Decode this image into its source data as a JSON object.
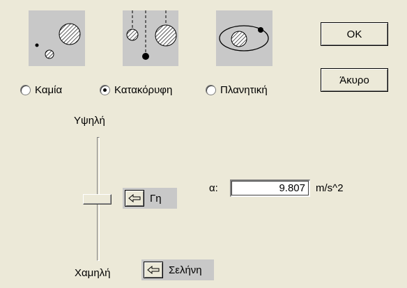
{
  "options": [
    {
      "label": "Καμία",
      "checked": false
    },
    {
      "label": "Κατακόρυφη",
      "checked": true
    },
    {
      "label": "Πλανητική",
      "checked": false
    }
  ],
  "buttons": {
    "ok": "OK",
    "cancel": "Άκυρο"
  },
  "slider": {
    "high_label": "Υψηλή",
    "low_label": "Χαμηλή",
    "level": 0.5
  },
  "presets": {
    "earth": "Γη",
    "moon": "Σελήνη"
  },
  "acceleration": {
    "label": "α:",
    "value": "9.807",
    "unit": "m/s^2"
  },
  "icons": {
    "none_picture": "balls-scattered-icon",
    "vertical_picture": "balls-hanging-icon",
    "planetary_picture": "orbit-icon",
    "preset_arrow": "arrow-left-icon"
  }
}
